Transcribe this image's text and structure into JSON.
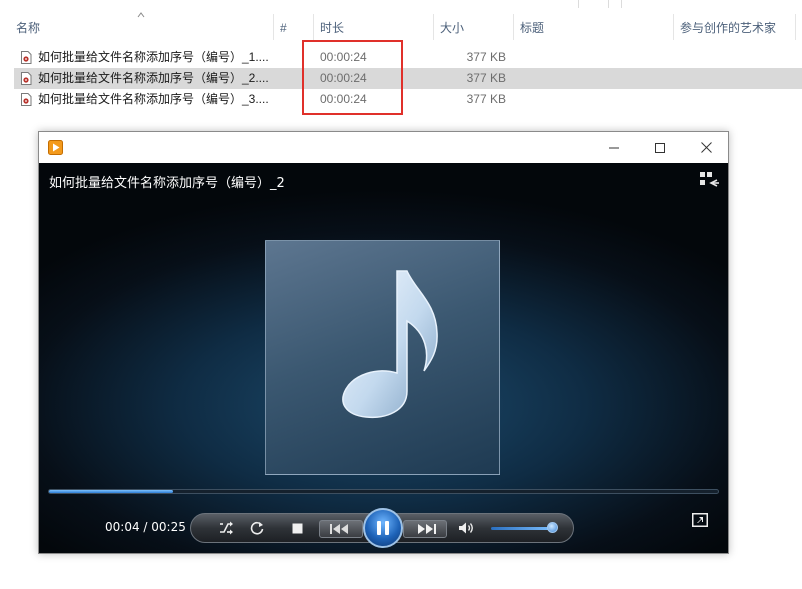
{
  "explorer": {
    "columns": {
      "name": "名称",
      "number": "#",
      "duration": "时长",
      "size": "大小",
      "title": "标题",
      "contributing_artists": "参与创作的艺术家"
    },
    "files": [
      {
        "name": "如何批量给文件名称添加序号（编号）_1....",
        "duration": "00:00:24",
        "size": "377 KB",
        "selected": false
      },
      {
        "name": "如何批量给文件名称添加序号（编号）_2....",
        "duration": "00:00:24",
        "size": "377 KB",
        "selected": true
      },
      {
        "name": "如何批量给文件名称添加序号（编号）_3....",
        "duration": "00:00:24",
        "size": "377 KB",
        "selected": false
      }
    ],
    "highlight_color": "#e0302a"
  },
  "player": {
    "now_playing": "如何批量给文件名称添加序号（编号）_2",
    "time_readout": "00:04 / 00:25",
    "progress_fraction": 0.185,
    "volume_fraction": 0.95,
    "state": "playing",
    "icons": {
      "app": "media-player-icon",
      "minimize": "minimize-icon",
      "maximize": "maximize-icon",
      "close": "close-icon",
      "layout": "switch-layout-icon",
      "shuffle": "shuffle-icon",
      "repeat": "repeat-icon",
      "stop": "stop-icon",
      "previous": "previous-icon",
      "pause": "pause-icon",
      "next": "next-icon",
      "mute": "speaker-icon",
      "switch_view": "switch-to-library-icon",
      "album_art": "music-note-icon"
    },
    "accent": "#2f7fd6"
  }
}
